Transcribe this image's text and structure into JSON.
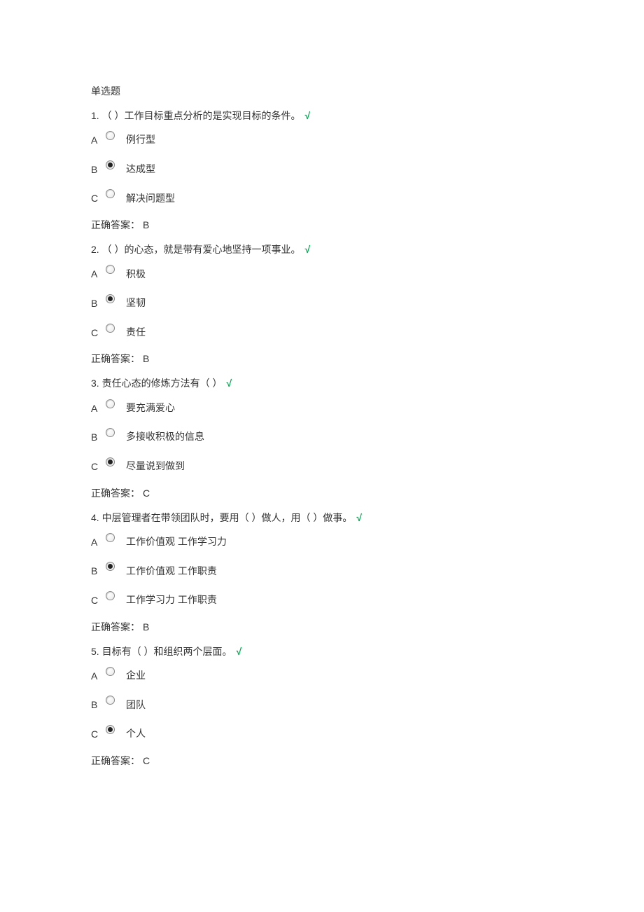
{
  "section_title": "单选题",
  "answer_label": "正确答案：",
  "checkmark": "√",
  "questions": [
    {
      "num": "1.",
      "text": "（ ）工作目标重点分析的是实现目标的条件。",
      "correct": true,
      "options": [
        {
          "letter": "A",
          "label": "例行型",
          "selected": false
        },
        {
          "letter": "B",
          "label": "达成型",
          "selected": true
        },
        {
          "letter": "C",
          "label": "解决问题型",
          "selected": false
        }
      ],
      "answer": "B"
    },
    {
      "num": "2.",
      "text": "（ ）的心态，就是带有爱心地坚持一项事业。",
      "correct": true,
      "options": [
        {
          "letter": "A",
          "label": "积极",
          "selected": false
        },
        {
          "letter": "B",
          "label": "坚韧",
          "selected": true
        },
        {
          "letter": "C",
          "label": "责任",
          "selected": false
        }
      ],
      "answer": "B"
    },
    {
      "num": "3.",
      "text": "责任心态的修炼方法有（ ）",
      "correct": true,
      "options": [
        {
          "letter": "A",
          "label": "要充满爱心",
          "selected": false
        },
        {
          "letter": "B",
          "label": "多接收积极的信息",
          "selected": false
        },
        {
          "letter": "C",
          "label": "尽量说到做到",
          "selected": true
        }
      ],
      "answer": "C"
    },
    {
      "num": "4.",
      "text": "中层管理者在带领团队时，要用（ ）做人，用（ ）做事。",
      "correct": true,
      "options": [
        {
          "letter": "A",
          "label": "工作价值观 工作学习力",
          "selected": false
        },
        {
          "letter": "B",
          "label": "工作价值观 工作职责",
          "selected": true
        },
        {
          "letter": "C",
          "label": "工作学习力 工作职责",
          "selected": false
        }
      ],
      "answer": "B"
    },
    {
      "num": "5.",
      "text": "目标有（ ）和组织两个层面。",
      "correct": true,
      "options": [
        {
          "letter": "A",
          "label": "企业",
          "selected": false
        },
        {
          "letter": "B",
          "label": "团队",
          "selected": false
        },
        {
          "letter": "C",
          "label": "个人",
          "selected": true
        }
      ],
      "answer": "C"
    }
  ]
}
